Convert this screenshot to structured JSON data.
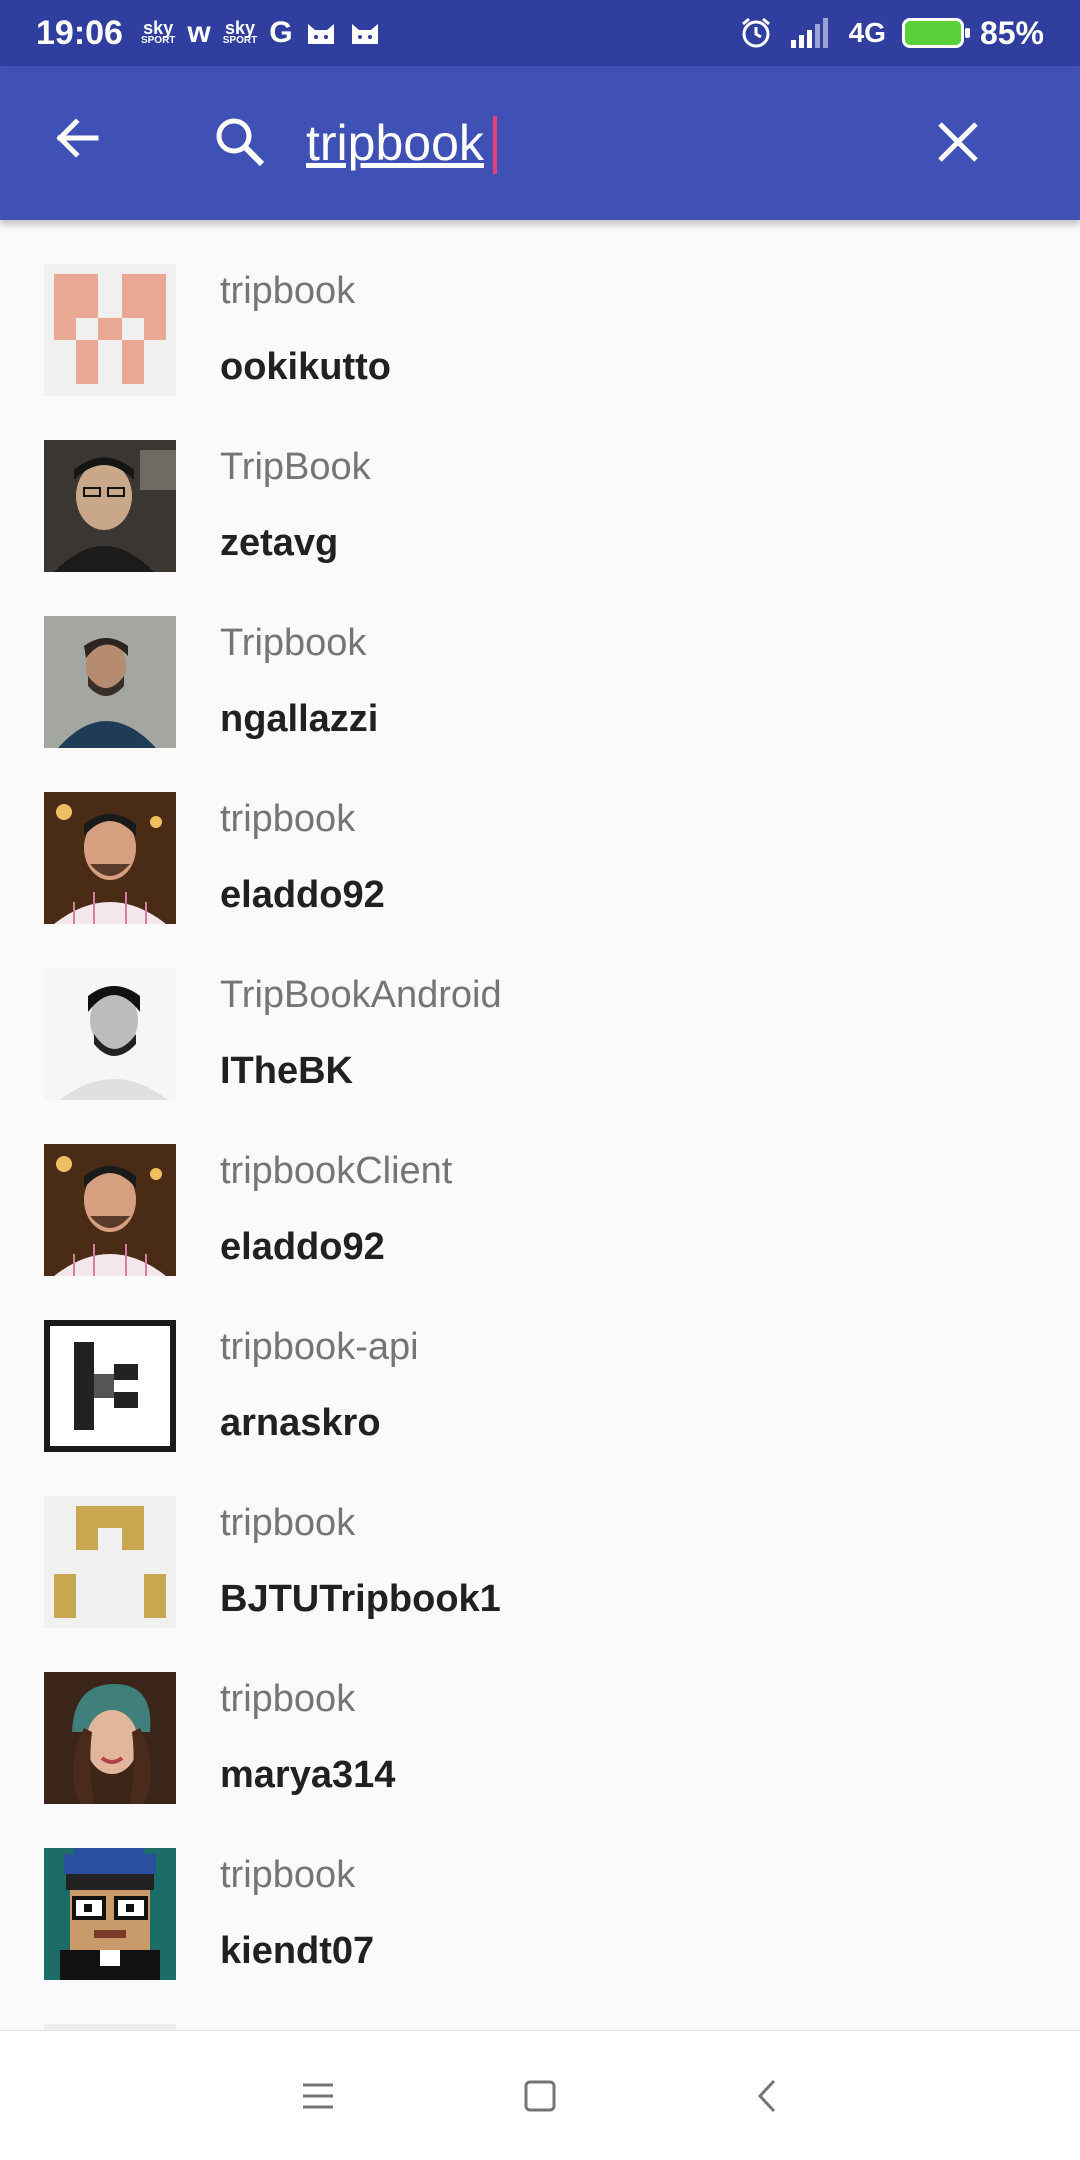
{
  "status_bar": {
    "time": "19:06",
    "left_icons": [
      "sky SPORT",
      "w",
      "sky SPORT",
      "G",
      "cat",
      "cat"
    ],
    "network": "4G",
    "battery": "85%"
  },
  "toolbar": {
    "search_value": "tripbook",
    "back_icon": "arrow-left-icon",
    "search_icon": "search-icon",
    "clear_icon": "close-icon",
    "background": "#3f51b5"
  },
  "results": [
    {
      "repo": "tripbook",
      "owner": "ookikutto"
    },
    {
      "repo": "TripBook",
      "owner": "zetavg"
    },
    {
      "repo": "Tripbook",
      "owner": "ngallazzi"
    },
    {
      "repo": "tripbook",
      "owner": "eladdo92"
    },
    {
      "repo": "TripBookAndroid",
      "owner": "ITheBK"
    },
    {
      "repo": "tripbookClient",
      "owner": "eladdo92"
    },
    {
      "repo": "tripbook-api",
      "owner": "arnaskro"
    },
    {
      "repo": "tripbook",
      "owner": "BJTUTripbook1"
    },
    {
      "repo": "tripbook",
      "owner": "marya314"
    },
    {
      "repo": "tripbook",
      "owner": "kiendt07"
    }
  ],
  "nav": {
    "menu_icon": "menu-icon",
    "home_icon": "home-square-icon",
    "back_icon": "back-chevron-icon"
  }
}
